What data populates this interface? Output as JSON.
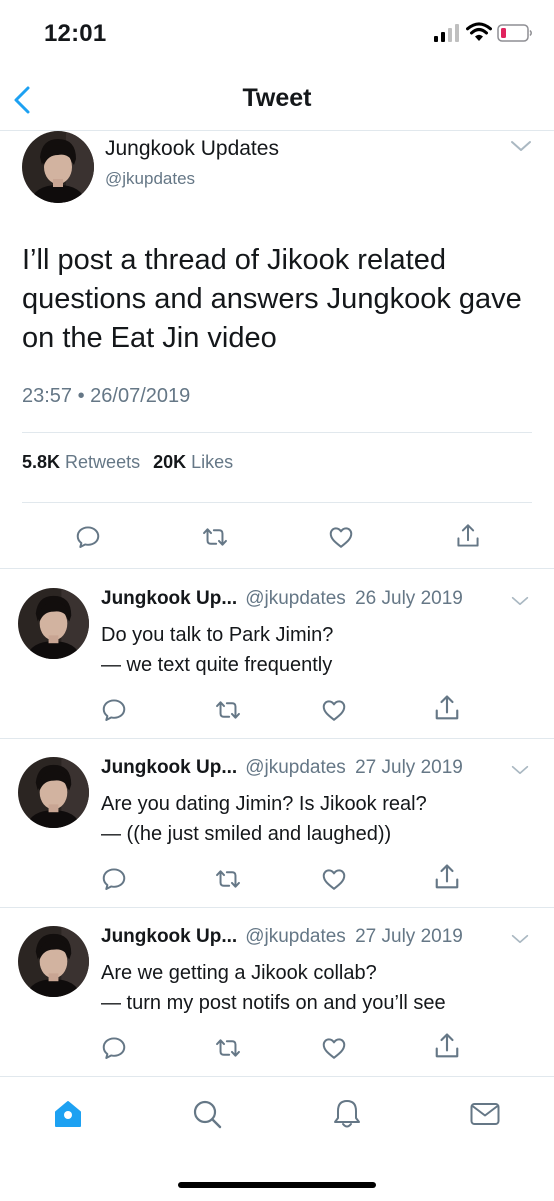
{
  "status_bar": {
    "time": "12:01"
  },
  "nav": {
    "title": "Tweet"
  },
  "main_tweet": {
    "name": "Jungkook Updates",
    "handle": "@jkupdates",
    "text": "I’ll post a thread of Jikook related questions and answers Jungkook gave on the Eat Jin video",
    "timestamp": "23:57 • 26/07/2019",
    "retweets_count": "5.8K",
    "retweets_label": "Retweets",
    "likes_count": "20K",
    "likes_label": "Likes"
  },
  "replies": [
    {
      "name": "Jungkook Up...",
      "handle": "@jkupdates",
      "date": "26 July 2019",
      "line1": "Do you talk to Park Jimin?",
      "line2": "— we text quite frequently"
    },
    {
      "name": "Jungkook Up...",
      "handle": "@jkupdates",
      "date": "27 July 2019",
      "line1": "Are you dating Jimin? Is Jikook real?",
      "line2": "— ((he just smiled and laughed))"
    },
    {
      "name": "Jungkook Up...",
      "handle": "@jkupdates",
      "date": "27 July 2019",
      "line1": "Are we getting a Jikook collab?",
      "line2": "— turn my post notifs on and you’ll see"
    }
  ],
  "icons": {
    "back": "chevron-left-icon",
    "caret": "chevron-down-icon",
    "reply": "reply-icon",
    "retweet": "retweet-icon",
    "like": "heart-icon",
    "share": "share-icon",
    "home": "home-icon",
    "search": "search-icon",
    "notifications": "bell-icon",
    "messages": "mail-icon"
  },
  "colors": {
    "accent": "#1da1f2",
    "text": "#14171a",
    "secondary": "#657786",
    "divider": "#e1e8ed",
    "battery_low": "#e0245e"
  }
}
